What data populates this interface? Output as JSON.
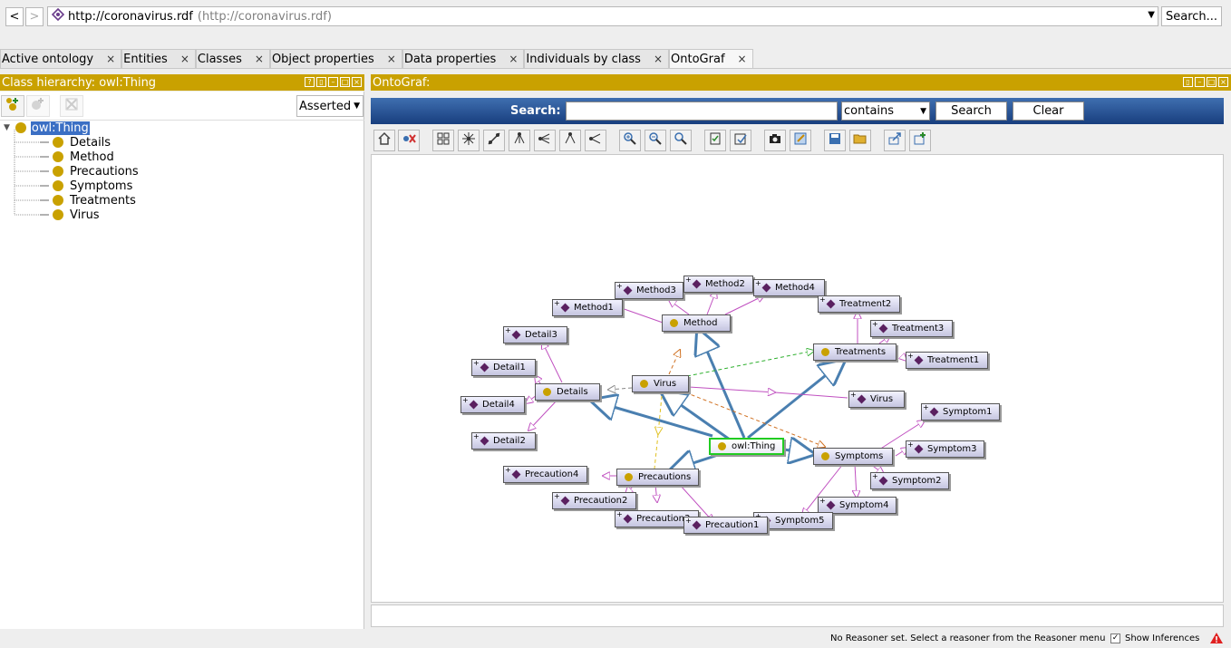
{
  "nav": {
    "back": "<",
    "forward": ">"
  },
  "address": {
    "url": "http://coronavirus.rdf",
    "url_hint": "(http://coronavirus.rdf)",
    "search_label": "Search..."
  },
  "tabs": [
    {
      "label": "Active ontology"
    },
    {
      "label": "Entities"
    },
    {
      "label": "Classes"
    },
    {
      "label": "Object properties"
    },
    {
      "label": "Data properties"
    },
    {
      "label": "Individuals by class"
    },
    {
      "label": "OntoGraf"
    }
  ],
  "tab_close": "×",
  "left_view": {
    "title": "Class hierarchy: owl:Thing",
    "mode": "Asserted",
    "root": "owl:Thing",
    "classes": [
      "Details",
      "Method",
      "Precautions",
      "Symptoms",
      "Treatments",
      "Virus"
    ]
  },
  "right_view": {
    "title": "OntoGraf:"
  },
  "search": {
    "label": "Search:",
    "value": "",
    "mode": "contains",
    "search_button": "Search",
    "clear_button": "Clear"
  },
  "graph": {
    "classes": [
      "owl:Thing",
      "Method",
      "Treatments",
      "Virus",
      "Details",
      "Symptoms",
      "Precautions"
    ],
    "individuals": [
      "Method3",
      "Method2",
      "Method4",
      "Method1",
      "Treatment2",
      "Treatment3",
      "Treatment1",
      "Detail3",
      "Detail1",
      "Detail4",
      "Detail2",
      "Virus",
      "Symptom1",
      "Symptom3",
      "Symptom2",
      "Symptom4",
      "Symptom5",
      "Precaution4",
      "Precaution2",
      "Precaution3",
      "Precaution1"
    ],
    "colors": {
      "subclass_edge": "#4a7fb0",
      "instance_edge": "#c050c0",
      "class_dot": "#c9a100",
      "individual_diamond": "#5a2060",
      "root_border": "#22cc22"
    }
  },
  "status": {
    "reasoner": "No Reasoner set. Select a reasoner from the Reasoner menu",
    "show_inferences": "Show Inferences",
    "show_inferences_checked": true
  }
}
